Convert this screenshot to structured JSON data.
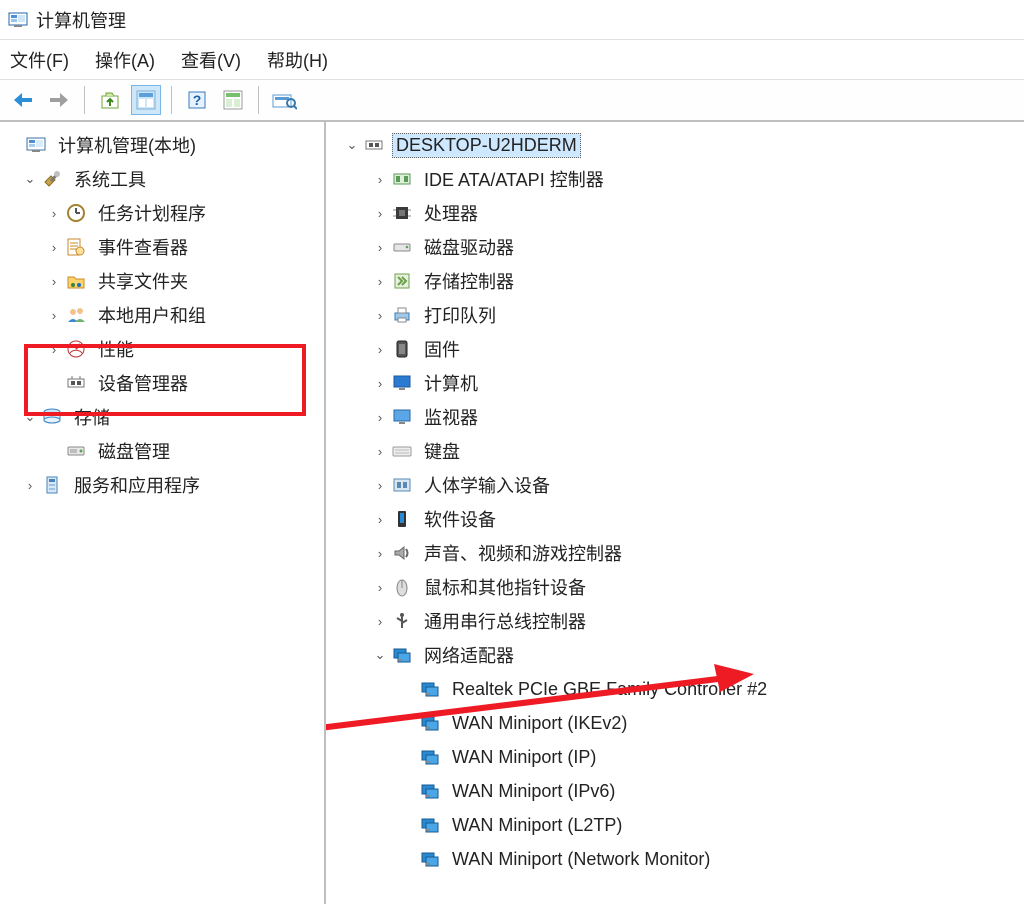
{
  "window": {
    "title": "计算机管理"
  },
  "menu": {
    "file": "文件(F)",
    "action": "操作(A)",
    "view": "查看(V)",
    "help": "帮助(H)"
  },
  "sidebar": {
    "root": "计算机管理(本地)",
    "system_tools": {
      "label": "系统工具",
      "children": [
        "任务计划程序",
        "事件查看器",
        "共享文件夹",
        "本地用户和组",
        "性能",
        "设备管理器"
      ]
    },
    "storage": {
      "label": "存储",
      "children": [
        "磁盘管理"
      ]
    },
    "services": {
      "label": "服务和应用程序"
    }
  },
  "devmgr": {
    "root": "DESKTOP-U2HDERM",
    "categories": [
      "IDE ATA/ATAPI 控制器",
      "处理器",
      "磁盘驱动器",
      "存储控制器",
      "打印队列",
      "固件",
      "计算机",
      "监视器",
      "键盘",
      "人体学输入设备",
      "软件设备",
      "声音、视频和游戏控制器",
      "鼠标和其他指针设备",
      "通用串行总线控制器",
      "网络适配器"
    ],
    "network_adapters": [
      "Realtek PCIe GBE Family Controller #2",
      "WAN Miniport (IKEv2)",
      "WAN Miniport (IP)",
      "WAN Miniport (IPv6)",
      "WAN Miniport (L2TP)",
      "WAN Miniport (Network Monitor)"
    ]
  }
}
